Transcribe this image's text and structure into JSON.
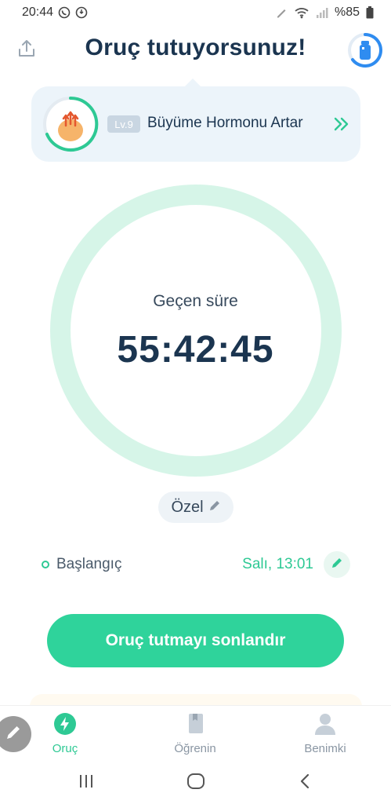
{
  "status_bar": {
    "time": "20:44",
    "battery": "%85",
    "icons": [
      "whatsapp-icon",
      "notification-icon",
      "pen-icon",
      "wifi-icon",
      "signal-icon",
      "battery-icon"
    ]
  },
  "header": {
    "title": "Oruç tutuyorsunuz!",
    "share_icon": "share-icon",
    "water_icon": "water-bottle-icon"
  },
  "stage": {
    "level": "Lv.9",
    "name": "Büyüme Hormonu Artar",
    "icon": "growth-hormone-icon",
    "arrow_icon": "double-chevron-right-icon"
  },
  "timer": {
    "label": "Geçen süre",
    "value": "55:42:45",
    "ring_color": "#d6f5e8"
  },
  "plan_chip": {
    "label": "Özel",
    "icon": "pencil-icon"
  },
  "start": {
    "label": "Başlangıç",
    "value": "Salı, 13:01",
    "edit_icon": "pencil-icon"
  },
  "end_button": {
    "label": "Oruç tutmayı sonlandır"
  },
  "bottom_nav": {
    "items": [
      {
        "label": "Oruç",
        "icon": "lightning-icon",
        "active": true
      },
      {
        "label": "Öğrenin",
        "icon": "book-icon",
        "active": false
      },
      {
        "label": "Benimki",
        "icon": "person-icon",
        "active": false
      }
    ]
  },
  "colors": {
    "accent": "#2fd39b",
    "title": "#1b3550",
    "card_bg": "#ecf4fa"
  }
}
